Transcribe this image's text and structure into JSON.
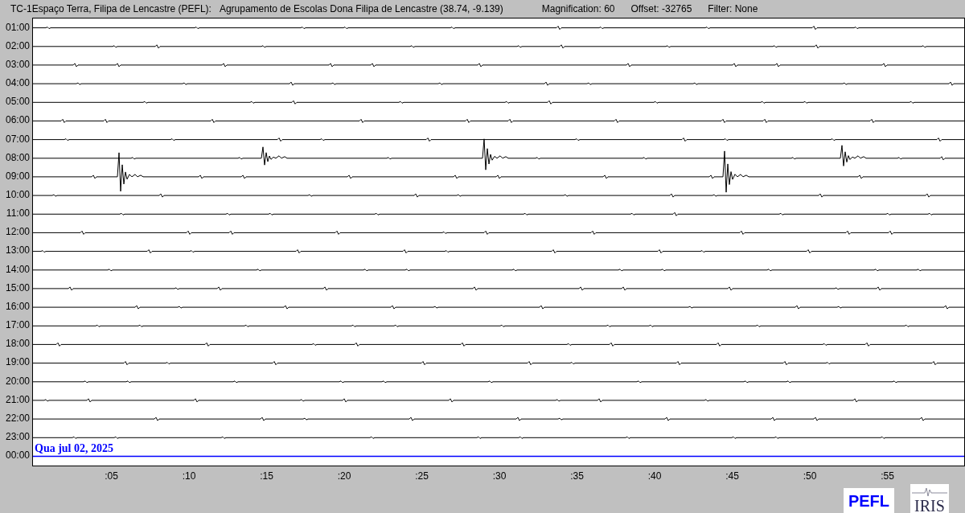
{
  "header": {
    "station": "TC-1Espaço Terra, Filipa de Lencastre (PEFL):",
    "site": "Agrupamento de Escolas Dona Filipa de Lencastre (38.74, -9.139)",
    "magnification": "Magnification: 60",
    "offset": "Offset: -32765",
    "filter": "Filter: None"
  },
  "plot": {
    "rows": [
      {
        "label": "01:00"
      },
      {
        "label": "02:00"
      },
      {
        "label": "03:00"
      },
      {
        "label": "04:00"
      },
      {
        "label": "05:00"
      },
      {
        "label": "06:00"
      },
      {
        "label": "07:00"
      },
      {
        "label": "08:00"
      },
      {
        "label": "09:00"
      },
      {
        "label": "10:00"
      },
      {
        "label": "11:00"
      },
      {
        "label": "12:00"
      },
      {
        "label": "13:00"
      },
      {
        "label": "14:00"
      },
      {
        "label": "15:00"
      },
      {
        "label": "16:00"
      },
      {
        "label": "17:00"
      },
      {
        "label": "18:00"
      },
      {
        "label": "19:00"
      },
      {
        "label": "20:00"
      },
      {
        "label": "21:00"
      },
      {
        "label": "22:00"
      },
      {
        "label": "23:00"
      },
      {
        "label": "00:00"
      }
    ],
    "date": "Qua jul 02, 2025",
    "xticks": [
      ":05",
      ":10",
      ":15",
      ":20",
      ":25",
      ":30",
      ":35",
      ":40",
      ":45",
      ":50",
      ":55"
    ]
  },
  "logos": {
    "station": "PEFL",
    "network": "IRIS"
  }
}
